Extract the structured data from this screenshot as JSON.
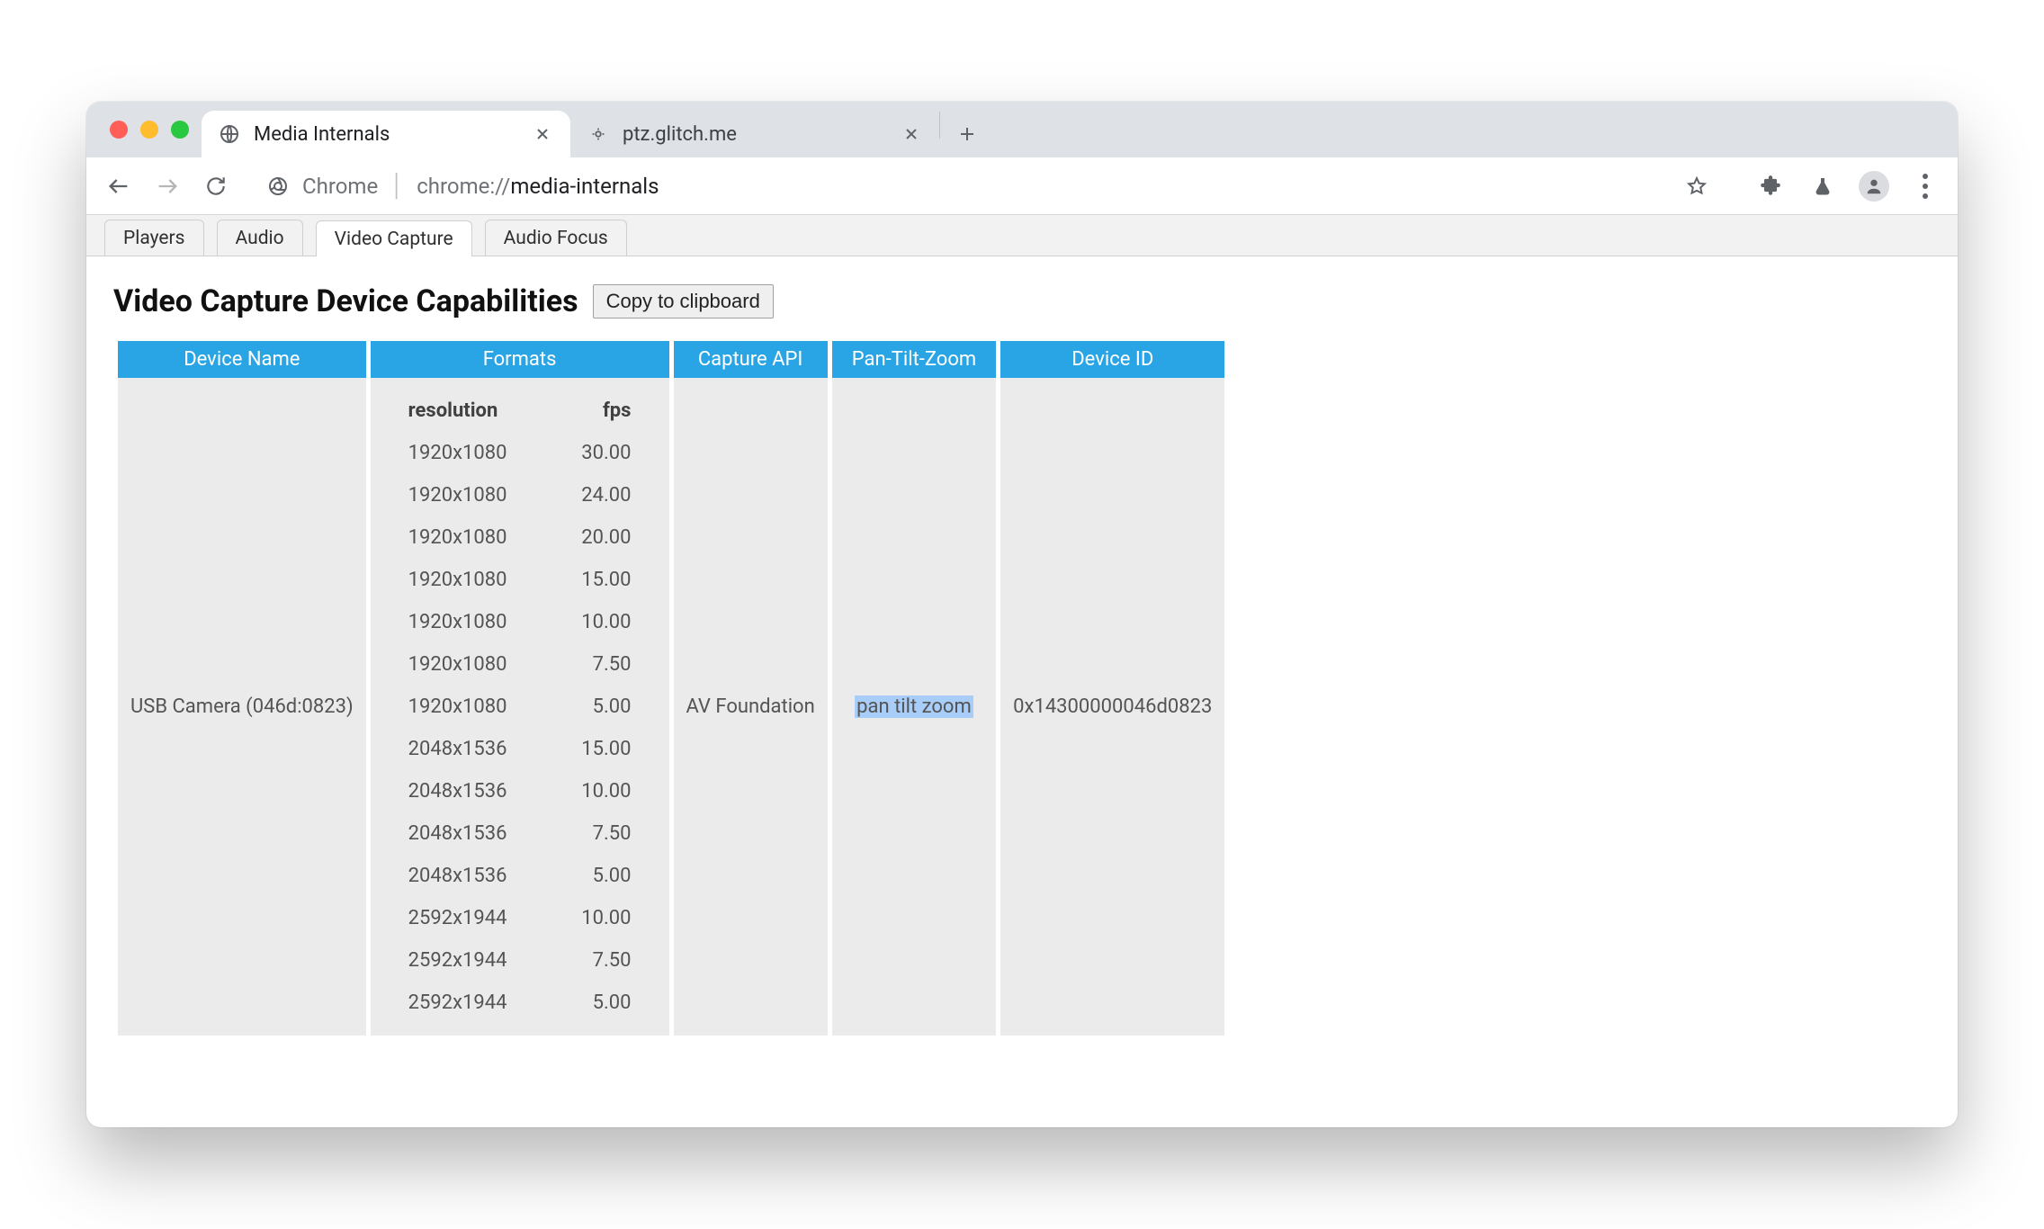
{
  "browser": {
    "tabs": [
      {
        "title": "Media Internals",
        "active": true
      },
      {
        "title": "ptz.glitch.me",
        "active": false
      }
    ],
    "omnibox": {
      "host": "Chrome",
      "url_prefix": "chrome://",
      "url_path": "media-internals"
    }
  },
  "page_tabs": {
    "items": [
      "Players",
      "Audio",
      "Video Capture",
      "Audio Focus"
    ],
    "active_index": 2
  },
  "heading": "Video Capture Device Capabilities",
  "copy_label": "Copy to clipboard",
  "table": {
    "headers": [
      "Device Name",
      "Formats",
      "Capture API",
      "Pan-Tilt-Zoom",
      "Device ID"
    ],
    "format_headers": {
      "resolution": "resolution",
      "fps": "fps"
    },
    "row": {
      "device_name": "USB Camera (046d:0823)",
      "capture_api": "AV Foundation",
      "ptz": "pan tilt zoom",
      "device_id": "0x14300000046d0823",
      "formats": [
        {
          "resolution": "1920x1080",
          "fps": "30.00"
        },
        {
          "resolution": "1920x1080",
          "fps": "24.00"
        },
        {
          "resolution": "1920x1080",
          "fps": "20.00"
        },
        {
          "resolution": "1920x1080",
          "fps": "15.00"
        },
        {
          "resolution": "1920x1080",
          "fps": "10.00"
        },
        {
          "resolution": "1920x1080",
          "fps": "7.50"
        },
        {
          "resolution": "1920x1080",
          "fps": "5.00"
        },
        {
          "resolution": "2048x1536",
          "fps": "15.00"
        },
        {
          "resolution": "2048x1536",
          "fps": "10.00"
        },
        {
          "resolution": "2048x1536",
          "fps": "7.50"
        },
        {
          "resolution": "2048x1536",
          "fps": "5.00"
        },
        {
          "resolution": "2592x1944",
          "fps": "10.00"
        },
        {
          "resolution": "2592x1944",
          "fps": "7.50"
        },
        {
          "resolution": "2592x1944",
          "fps": "5.00"
        }
      ]
    }
  }
}
